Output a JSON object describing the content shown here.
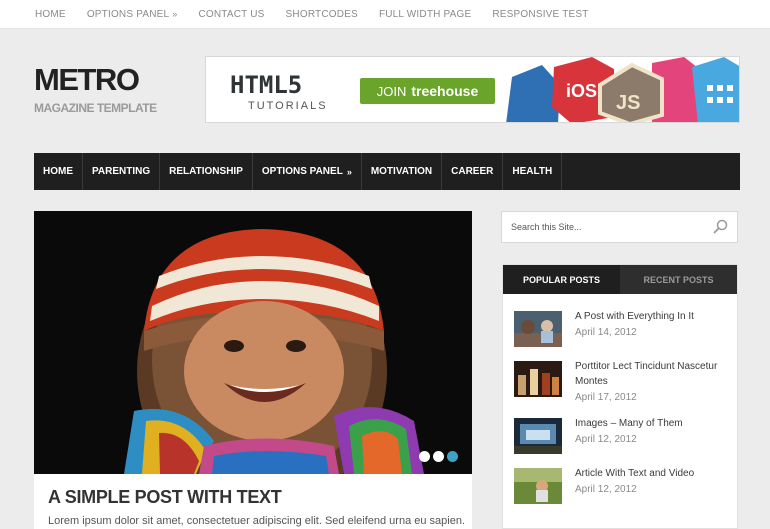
{
  "topnav": {
    "items": [
      {
        "label": "HOME",
        "arrow": ""
      },
      {
        "label": "OPTIONS PANEL",
        "arrow": "»"
      },
      {
        "label": "CONTACT US",
        "arrow": ""
      },
      {
        "label": "SHORTCODES",
        "arrow": ""
      },
      {
        "label": "FULL WIDTH PAGE",
        "arrow": ""
      },
      {
        "label": "RESPONSIVE TEST",
        "arrow": ""
      }
    ]
  },
  "logo": {
    "title": "METRO",
    "subtitle": "MAGAZINE TEMPLATE"
  },
  "banner": {
    "heading": "HTML5",
    "subheading": "TUTORIALS",
    "button_prefix": "JOIN",
    "button_brand": "treehouse",
    "badges": [
      "iOS",
      "JS"
    ],
    "colors": {
      "button": "#6aa42a"
    }
  },
  "mainnav": {
    "items": [
      {
        "label": "HOME",
        "arrow": ""
      },
      {
        "label": "PARENTING",
        "arrow": ""
      },
      {
        "label": "RELATIONSHIP",
        "arrow": ""
      },
      {
        "label": "OPTIONS PANEL",
        "arrow": "»"
      },
      {
        "label": "MOTIVATION",
        "arrow": ""
      },
      {
        "label": "CAREER",
        "arrow": ""
      },
      {
        "label": "HEALTH",
        "arrow": ""
      }
    ]
  },
  "featured": {
    "slides": 3,
    "active_slide": 3,
    "post_title": "A SIMPLE POST WITH TEXT",
    "excerpt": "Lorem ipsum dolor sit amet, consectetuer adipiscing elit. Sed eleifend urna eu sapien."
  },
  "search": {
    "placeholder": "Search this Site...",
    "icon": "search-icon"
  },
  "widget": {
    "tabs": [
      {
        "label": "POPULAR POSTS",
        "active": true
      },
      {
        "label": "RECENT POSTS",
        "active": false
      }
    ],
    "posts": [
      {
        "title": "A Post with Everything In It",
        "date": "April 14, 2012"
      },
      {
        "title": "Porttitor Lect Tincidunt Nascetur Montes",
        "date": "April 17, 2012"
      },
      {
        "title": "Images – Many of Them",
        "date": "April 12, 2012"
      },
      {
        "title": "Article With Text and Video",
        "date": "April 12, 2012"
      }
    ]
  },
  "colors": {
    "accent": "#3ea0c5",
    "nav_bg": "#1f1f1f"
  }
}
